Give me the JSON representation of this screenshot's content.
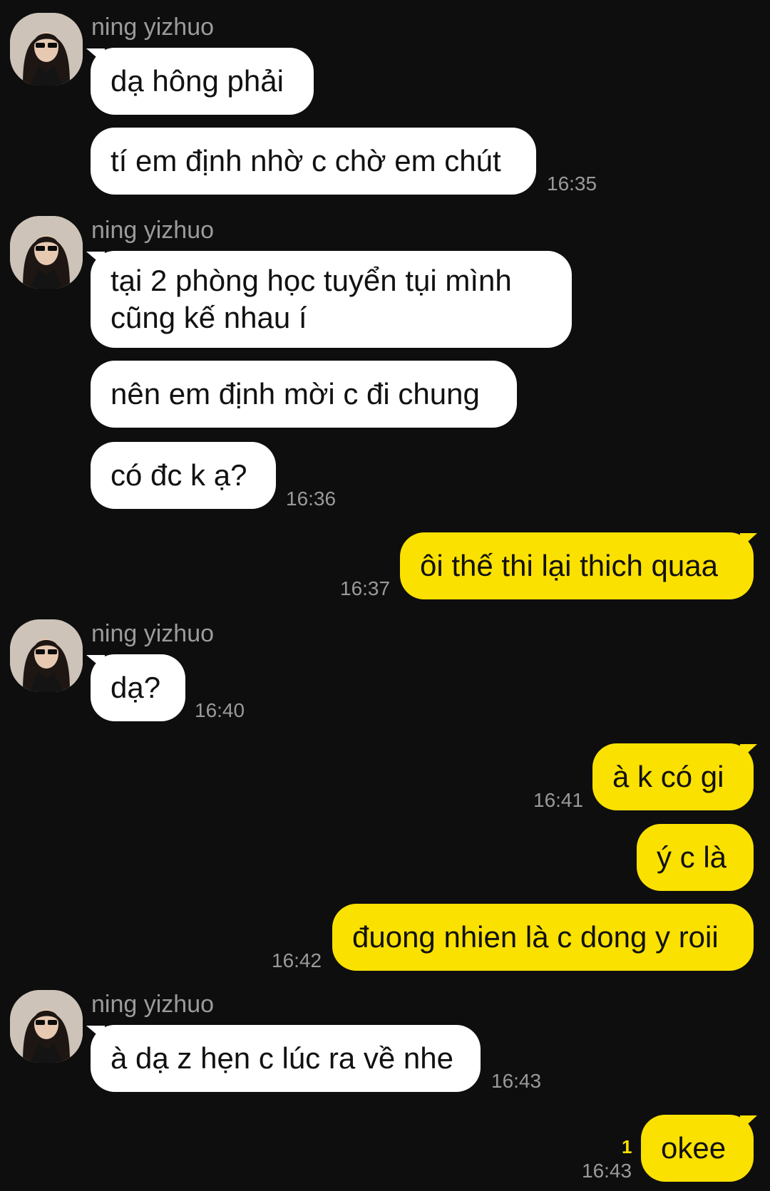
{
  "sender_name": "ning yizhuo",
  "avatar_icon": "profile-photo-avatar",
  "colors": {
    "background": "#0e0e0e",
    "incoming_bubble": "#ffffff",
    "outgoing_bubble": "#fae100",
    "timestamp": "#9a9a9a",
    "unread_count": "#fae100"
  },
  "messages": [
    {
      "from": "them",
      "text": "dạ hông phải"
    },
    {
      "from": "them",
      "text": "tí em định nhờ c chờ em chút",
      "time": "16:35"
    },
    {
      "from": "them",
      "lines": [
        "tại 2 phòng học tuyển tụi mình",
        "cũng kế nhau í"
      ]
    },
    {
      "from": "them",
      "text": "nên em định mời c đi chung"
    },
    {
      "from": "them",
      "text": "có đc k ạ?",
      "time": "16:36"
    },
    {
      "from": "me",
      "text": "ôi thế thi lại thich quaa",
      "time": "16:37"
    },
    {
      "from": "them",
      "text": "dạ?",
      "time": "16:40"
    },
    {
      "from": "me",
      "text": "à k có gi",
      "time": "16:41"
    },
    {
      "from": "me",
      "text": "ý c là"
    },
    {
      "from": "me",
      "text": "đuong nhien là c dong y roii",
      "time": "16:42"
    },
    {
      "from": "them",
      "text": "à dạ z hẹn c lúc ra về nhe",
      "time": "16:43"
    },
    {
      "from": "me",
      "text": "okee",
      "time": "16:43",
      "unread": "1"
    }
  ]
}
